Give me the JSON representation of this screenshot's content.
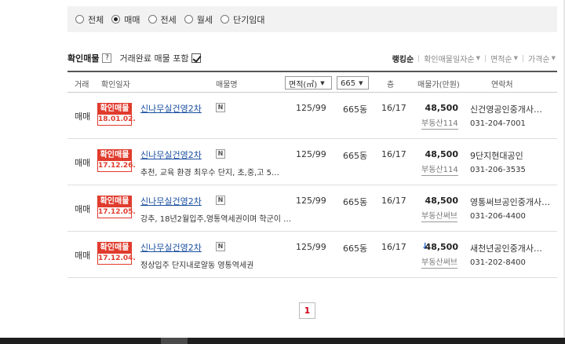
{
  "filter": {
    "options": [
      {
        "label": "전체",
        "selected": false
      },
      {
        "label": "매매",
        "selected": true
      },
      {
        "label": "전세",
        "selected": false
      },
      {
        "label": "월세",
        "selected": false
      },
      {
        "label": "단기임대",
        "selected": false
      }
    ]
  },
  "options_row": {
    "title": "확인매물",
    "help": "?",
    "include_done_label": "거래완료 매물 포함",
    "include_done_checked": true,
    "sort": [
      {
        "label": "랭킹순",
        "active": true
      },
      {
        "label": "확인매물일자순",
        "active": false
      },
      {
        "label": "면적순",
        "active": false
      },
      {
        "label": "가격순",
        "active": false
      }
    ]
  },
  "table": {
    "headers": {
      "type": "거래",
      "date": "확인일자",
      "name": "매물명",
      "area": "면적(㎡)",
      "dong": "665",
      "floor": "층",
      "price": "매물가(만원)",
      "contact": "연락처"
    },
    "rows": [
      {
        "type": "매매",
        "stamp": "확인매물",
        "date": "18.01.02.",
        "name": "신나무실건영2차",
        "badge": "N",
        "desc": "",
        "area": "125/99",
        "dong": "665동",
        "floor": "16/17",
        "price": "48,500",
        "price_down": false,
        "source": "부동산114",
        "agent": "신건영공인중개사…",
        "phone": "031-204-7001"
      },
      {
        "type": "매매",
        "stamp": "확인매물",
        "date": "17.12.26.",
        "name": "신나무실건영2차",
        "badge": "N",
        "desc": "추천, 교육 환경 최우수 단지, 초,중,고 5…",
        "area": "125/99",
        "dong": "665동",
        "floor": "16/17",
        "price": "48,500",
        "price_down": false,
        "source": "부동산114",
        "agent": "9단지현대공인",
        "phone": "031-206-3535"
      },
      {
        "type": "매매",
        "stamp": "확인매물",
        "date": "17.12.05.",
        "name": "신나무실건영2차",
        "badge": "N",
        "desc": "강추, 18년2월입주,영통역세권이며 학군이 …",
        "area": "125/99",
        "dong": "665동",
        "floor": "16/17",
        "price": "48,500",
        "price_down": false,
        "source": "부동산써브",
        "agent": "영통써브공인중개사…",
        "phone": "031-206-4400"
      },
      {
        "type": "매매",
        "stamp": "확인매물",
        "date": "17.12.04.",
        "name": "신나무실건영2차",
        "badge": "N",
        "desc": "정상입주 단지내로얄동 영통역세권",
        "area": "125/99",
        "dong": "665동",
        "floor": "16/17",
        "price": "48,500",
        "price_down": true,
        "source": "부동산써브",
        "agent": "새천년공인중개사…",
        "phone": "031-202-8400"
      }
    ]
  },
  "pagination": {
    "current": "1"
  },
  "colors": {
    "stamp_red": "#e03b2d",
    "link_blue": "#1a4fa0",
    "down_arrow": "#1a5fc9",
    "page_red": "#d0021b"
  }
}
